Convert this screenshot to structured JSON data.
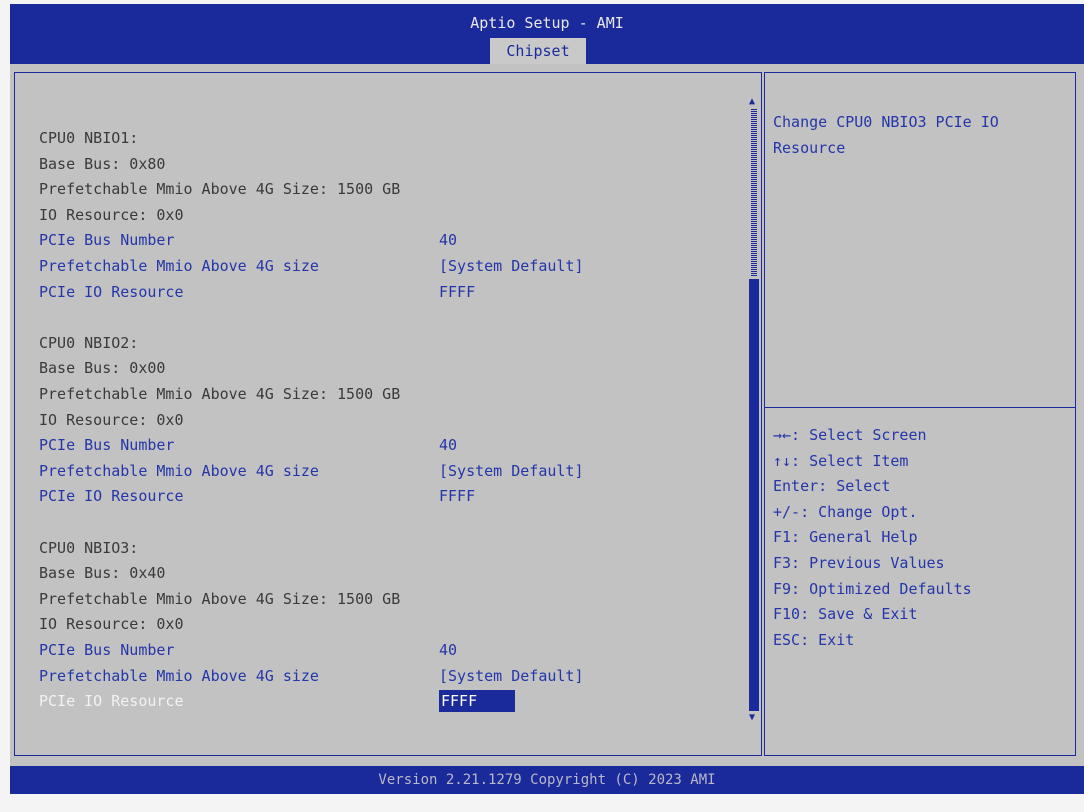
{
  "header": {
    "title": "Aptio Setup - AMI",
    "active_tab": "Chipset"
  },
  "main": {
    "sections": [
      {
        "heading": "CPU0 NBIO1:",
        "base_bus": "Base Bus: 0x80",
        "mmio_size": "Prefetchable Mmio Above 4G Size: 1500 GB",
        "io_resource": "IO Resource: 0x0",
        "options": [
          {
            "label": "PCIe Bus Number",
            "value": "40"
          },
          {
            "label": "Prefetchable Mmio Above 4G size",
            "value": "[System Default]"
          },
          {
            "label": "PCIe IO Resource",
            "value": "FFFF"
          }
        ]
      },
      {
        "heading": "CPU0 NBIO2:",
        "base_bus": "Base Bus: 0x00",
        "mmio_size": "Prefetchable Mmio Above 4G Size: 1500 GB",
        "io_resource": "IO Resource: 0x0",
        "options": [
          {
            "label": "PCIe Bus Number",
            "value": "40"
          },
          {
            "label": "Prefetchable Mmio Above 4G size",
            "value": "[System Default]"
          },
          {
            "label": "PCIe IO Resource",
            "value": "FFFF"
          }
        ]
      },
      {
        "heading": "CPU0 NBIO3:",
        "base_bus": "Base Bus: 0x40",
        "mmio_size": "Prefetchable Mmio Above 4G Size: 1500 GB",
        "io_resource": "IO Resource: 0x0",
        "options": [
          {
            "label": "PCIe Bus Number",
            "value": "40"
          },
          {
            "label": "Prefetchable Mmio Above 4G size",
            "value": "[System Default]"
          },
          {
            "label": "PCIe IO Resource",
            "value": "FFFF"
          }
        ]
      }
    ]
  },
  "help": {
    "description": "Change CPU0 NBIO3 PCIe IO Resource",
    "keys": [
      "→←: Select Screen",
      "↑↓: Select Item",
      "Enter: Select",
      "+/-: Change Opt.",
      "F1: General Help",
      "F3: Previous Values",
      "F9: Optimized Defaults",
      "F10: Save & Exit",
      "ESC: Exit"
    ]
  },
  "footer": {
    "version": "Version 2.21.1279 Copyright (C) 2023 AMI"
  },
  "colors": {
    "header_blue": "#1a2a9a",
    "panel_gray": "#c2c2c2",
    "option_blue": "#2436a8",
    "info_text": "#3a3a3a"
  }
}
